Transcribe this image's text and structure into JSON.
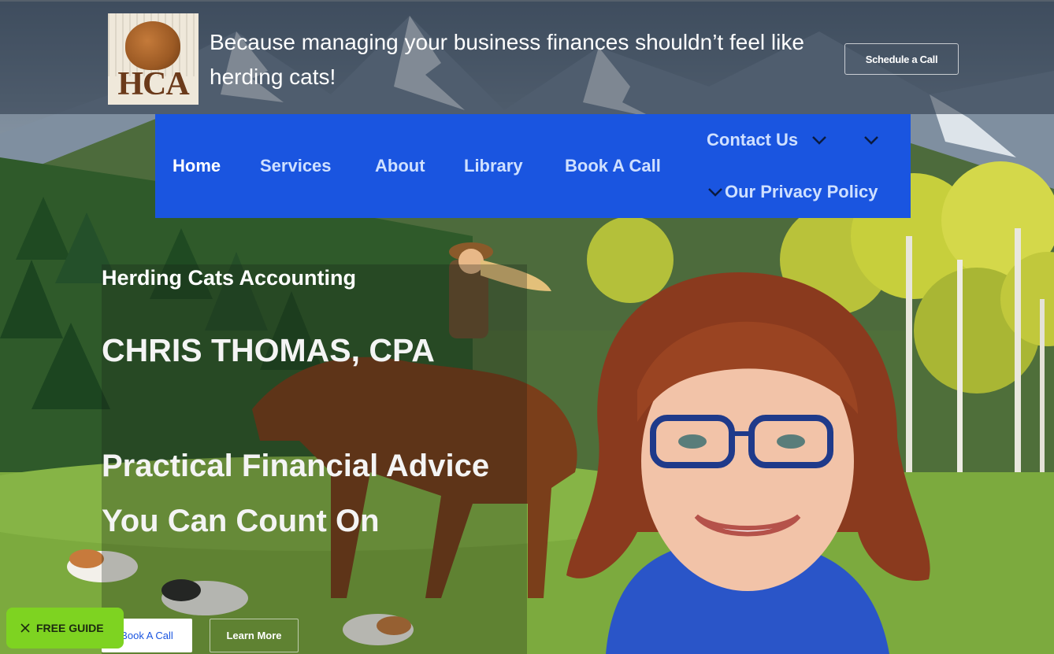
{
  "header": {
    "logo_text": "HCA",
    "tagline": "Because managing your business finances shouldn’t feel like herding cats!",
    "schedule_button": "Schedule a Call"
  },
  "nav": {
    "items": [
      {
        "label": "Home",
        "active": true
      },
      {
        "label": "Services",
        "active": false
      },
      {
        "label": "About",
        "active": false
      },
      {
        "label": "Library",
        "active": false
      },
      {
        "label": "Book A Call",
        "active": false
      },
      {
        "label": "Contact Us",
        "active": false
      },
      {
        "label": "Our Privacy Policy",
        "active": false
      }
    ]
  },
  "hero": {
    "eyebrow": "Herding Cats Accounting",
    "name": "CHRIS THOMAS, CPA",
    "headline_line1": "Practical Financial Advice",
    "headline_line2": "You Can Count On",
    "book_button": "Book A Call",
    "learn_button": "Learn More"
  },
  "free_guide": {
    "label": "FREE GUIDE",
    "icon": "close-icon"
  },
  "colors": {
    "nav_bg": "#1a55e0",
    "nav_active": "#ffffff",
    "nav_link": "#cfe0ff",
    "guide_bg": "#7ed321",
    "header_overlay": "rgba(40,52,70,0.55)"
  }
}
